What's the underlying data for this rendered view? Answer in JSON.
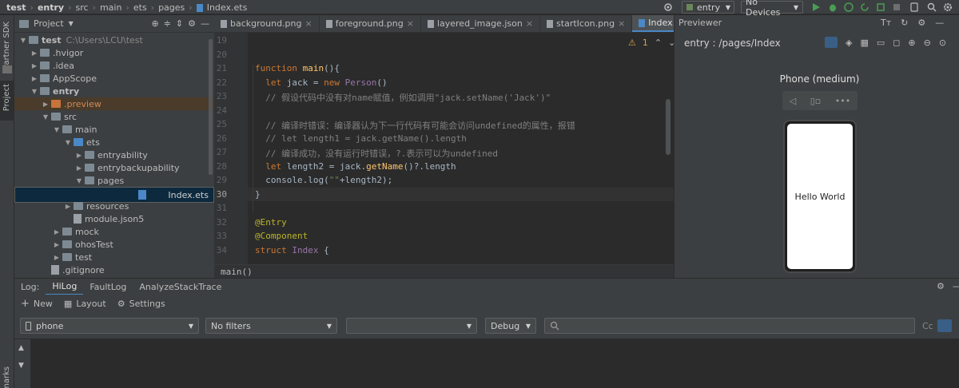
{
  "breadcrumbs": [
    "test",
    "entry",
    "src",
    "main",
    "ets",
    "pages",
    "Index.ets"
  ],
  "toolbar": {
    "run_config": "entry",
    "device": "No Devices"
  },
  "left_strip": {
    "partner_sdk": "Partner SDK",
    "project": "Project",
    "bookmarks": "marks"
  },
  "project_panel": {
    "title": "Project",
    "tree": [
      {
        "label": "test",
        "extra": "C:\\Users\\LCU\\test",
        "depth": 0,
        "kind": "folder",
        "open": true
      },
      {
        "label": ".hvigor",
        "depth": 1,
        "kind": "folder",
        "open": false
      },
      {
        "label": ".idea",
        "depth": 1,
        "kind": "folder",
        "open": false
      },
      {
        "label": "AppScope",
        "depth": 1,
        "kind": "folder",
        "open": false
      },
      {
        "label": "entry",
        "depth": 1,
        "kind": "folder",
        "open": true
      },
      {
        "label": ".preview",
        "depth": 2,
        "kind": "folder-orange",
        "open": false
      },
      {
        "label": "src",
        "depth": 2,
        "kind": "folder",
        "open": true
      },
      {
        "label": "main",
        "depth": 3,
        "kind": "folder",
        "open": true
      },
      {
        "label": "ets",
        "depth": 4,
        "kind": "folder-blue",
        "open": true
      },
      {
        "label": "entryability",
        "depth": 5,
        "kind": "folder",
        "open": false
      },
      {
        "label": "entrybackupability",
        "depth": 5,
        "kind": "folder",
        "open": false
      },
      {
        "label": "pages",
        "depth": 5,
        "kind": "folder",
        "open": true
      },
      {
        "label": "Index.ets",
        "depth": 6,
        "kind": "ets",
        "open": null
      },
      {
        "label": "resources",
        "depth": 4,
        "kind": "folder",
        "open": false
      },
      {
        "label": "module.json5",
        "depth": 4,
        "kind": "file",
        "open": null
      },
      {
        "label": "mock",
        "depth": 3,
        "kind": "folder",
        "open": false
      },
      {
        "label": "ohosTest",
        "depth": 3,
        "kind": "folder",
        "open": false
      },
      {
        "label": "test",
        "depth": 3,
        "kind": "folder",
        "open": false
      },
      {
        "label": ".gitignore",
        "depth": 2,
        "kind": "file",
        "open": null
      }
    ]
  },
  "editor": {
    "tabs": [
      {
        "label": "background.png",
        "active": false
      },
      {
        "label": "foreground.png",
        "active": false
      },
      {
        "label": "layered_image.json",
        "active": false
      },
      {
        "label": "startIcon.png",
        "active": false
      },
      {
        "label": "Index.ets",
        "active": true
      }
    ],
    "warning_count": "1",
    "line_numbers": [
      "19",
      "20",
      "21",
      "22",
      "23",
      "24",
      "25",
      "26",
      "27",
      "28",
      "29",
      "30",
      "31",
      "32",
      "33",
      "34"
    ],
    "code_lines": [
      [],
      [],
      [
        [
          "kw",
          "function "
        ],
        [
          "fn",
          "main"
        ],
        [
          "",
          "(){"
        ]
      ],
      [
        [
          "kw",
          "  let "
        ],
        [
          "",
          "jack = "
        ],
        [
          "kw",
          "new "
        ],
        [
          "ty",
          "Person"
        ],
        [
          "",
          "()"
        ]
      ],
      [
        [
          "cm",
          "  // 假设代码中没有对name赋值，例如调用\"jack.setName('Jack')\""
        ]
      ],
      [],
      [
        [
          "cm",
          "  // 编译时错误：编译器认为下一行代码有可能会访问undefined的属性，报错"
        ]
      ],
      [
        [
          "cm",
          "  // let length1 = jack.getName().length"
        ]
      ],
      [
        [
          "cm",
          "  // 编译成功，没有运行时错误，?.表示可以为undefined"
        ]
      ],
      [
        [
          "kw",
          "  let "
        ],
        [
          "",
          "length2 = jack."
        ],
        [
          "fn",
          "getName"
        ],
        [
          "",
          "()?.length"
        ]
      ],
      [
        [
          "",
          "  console.log("
        ],
        [
          "st",
          "\"\""
        ],
        [
          "",
          "+length2);"
        ]
      ],
      [
        [
          "",
          "}"
        ]
      ],
      [],
      [
        [
          "an",
          "@Entry"
        ]
      ],
      [
        [
          "an",
          "@Component"
        ]
      ],
      [
        [
          "kw",
          "struct "
        ],
        [
          "ty",
          "Index "
        ],
        [
          "",
          "{"
        ]
      ]
    ],
    "status_fn": "main()"
  },
  "previewer": {
    "title": "Previewer",
    "path": "entry : /pages/Index",
    "device_name": "Phone (medium)",
    "screen_text": "Hello World"
  },
  "log": {
    "label": "Log:",
    "tabs": [
      {
        "label": "HiLog",
        "active": true
      },
      {
        "label": "FaultLog",
        "active": false
      },
      {
        "label": "AnalyzeStackTrace",
        "active": false
      }
    ],
    "new_label": "New",
    "layout_label": "Layout",
    "settings_label": "Settings",
    "device_filter": "phone",
    "filter": "No filters",
    "app_filter": "",
    "level": "Debug",
    "search_placeholder": "",
    "case_label": "Cc"
  },
  "colors": {
    "accent": "#4a88c7",
    "keyword": "#cc7832",
    "function": "#ffc66d",
    "comment": "#808080",
    "annotation": "#bbb529",
    "string": "#6a8759",
    "type": "#9876aa"
  }
}
